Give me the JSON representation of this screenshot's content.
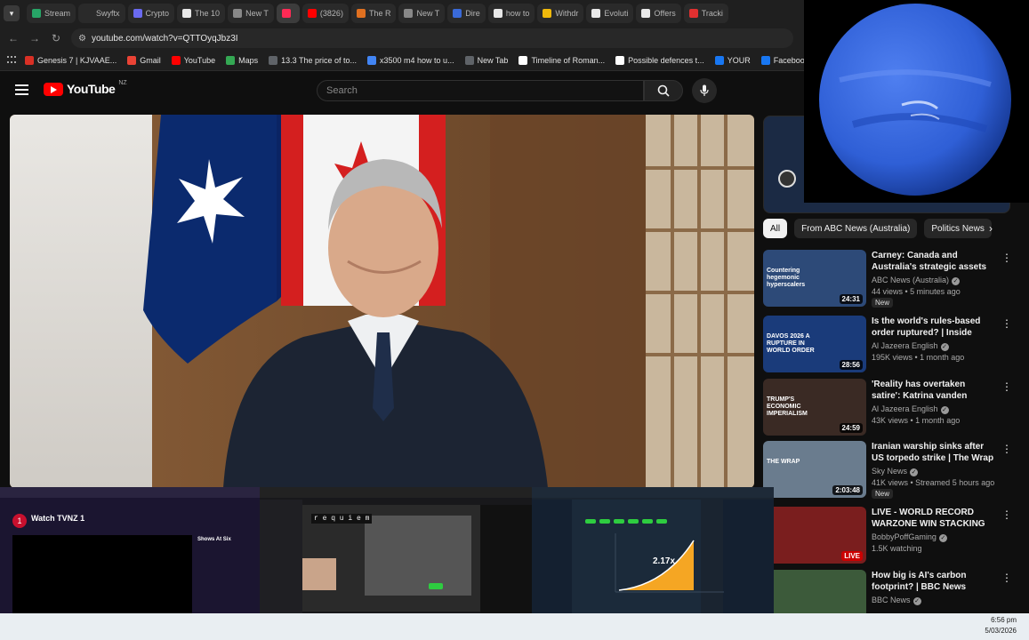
{
  "browser": {
    "tabs": [
      {
        "label": "Stream",
        "color": "#27a567"
      },
      {
        "label": "Swyftx",
        "color": "#2a2a2a"
      },
      {
        "label": "Crypto",
        "color": "#6a6af0"
      },
      {
        "label": "The 10",
        "color": "#e8e8e8"
      },
      {
        "label": "New T",
        "color": "#888888"
      },
      {
        "label": "",
        "color": "#ff2a55",
        "active": true
      },
      {
        "label": "(3826)",
        "color": "#ff0000"
      },
      {
        "label": "The R",
        "color": "#e07020"
      },
      {
        "label": "New T",
        "color": "#888888"
      },
      {
        "label": "Dire",
        "color": "#3a6ad8"
      },
      {
        "label": "how to",
        "color": "#e8e8e8"
      },
      {
        "label": "Withdr",
        "color": "#f0b90b"
      },
      {
        "label": "Evoluti",
        "color": "#e8e8e8"
      },
      {
        "label": "Offers",
        "color": "#e8e8e8"
      },
      {
        "label": "Tracki",
        "color": "#e03030"
      }
    ],
    "url": "youtube.com/watch?v=QTTOyqJbz3I",
    "bookmarks": [
      {
        "label": "Genesis 7 | KJVAAE...",
        "color": "#d93025"
      },
      {
        "label": "Gmail",
        "color": "#ea4335"
      },
      {
        "label": "YouTube",
        "color": "#ff0000"
      },
      {
        "label": "Maps",
        "color": "#34a853"
      },
      {
        "label": "13.3 The price of to...",
        "color": "#5f6368"
      },
      {
        "label": "x3500 m4 how to u...",
        "color": "#4285f4"
      },
      {
        "label": "New Tab",
        "color": "#5f6368"
      },
      {
        "label": "Timeline of Roman...",
        "color": "#ffffff"
      },
      {
        "label": "Possible defences t...",
        "color": "#ffffff"
      },
      {
        "label": "YOUR",
        "color": "#1877f2"
      },
      {
        "label": "Facebook green",
        "color": "#1877f2"
      }
    ]
  },
  "youtube": {
    "logo_text": "YouTube",
    "country": "NZ",
    "search_placeholder": "Search",
    "chips": [
      "All",
      "From ABC News (Australia)",
      "Politics News"
    ],
    "recommendations": [
      {
        "title": "Carney: Canada and Australia's strategic assets to counter ...",
        "channel": "ABC News (Australia)",
        "meta": "44 views • 5 minutes ago",
        "badge": "New",
        "duration": "24:31",
        "thumb_text": "Countering hegemonic hyperscalers",
        "thumb_color": "#2d4a78"
      },
      {
        "title": "Is the world's rules-based order ruptured? | Inside Story",
        "channel": "Al Jazeera English",
        "meta": "195K views • 1 month ago",
        "badge": "",
        "duration": "28:56",
        "thumb_text": "DAVOS 2026 A RUPTURE IN WORLD ORDER",
        "thumb_color": "#1a3b7a"
      },
      {
        "title": "'Reality has overtaken satire': Katrina vanden Heuvel on ...",
        "channel": "Al Jazeera English",
        "meta": "43K views • 1 month ago",
        "badge": "",
        "duration": "24:59",
        "thumb_text": "TRUMP'S ECONOMIC IMPERIALISM",
        "thumb_color": "#3a2a24"
      },
      {
        "title": "Iranian warship sinks after US torpedo strike | The Wrap with ...",
        "channel": "Sky News",
        "meta": "41K views • Streamed 5 hours ago",
        "badge": "New",
        "duration": "2:03:48",
        "thumb_text": "THE WRAP",
        "thumb_color": "#6a7c8e"
      },
      {
        "title": "LIVE - WORLD RECORD WARZONE WIN STACKING",
        "channel": "BobbyPoffGaming",
        "meta": "1.5K watching",
        "badge": "",
        "duration": "LIVE",
        "thumb_text": "",
        "thumb_color": "#7a1e1e"
      },
      {
        "title": "How big is AI's carbon footprint? | BBC News",
        "channel": "BBC News",
        "meta": "",
        "badge": "",
        "duration": "",
        "thumb_text": "",
        "thumb_color": "#3c5a3a"
      }
    ]
  },
  "overlays": {
    "win1_title": "Watch TVNZ 1",
    "win1_side_heading": "Shows At Six",
    "win2_overlay_text": "r e q u i e m",
    "win3_multiplier": "2.17x"
  },
  "taskbar": {
    "time": "6:56 pm",
    "date": "5/03/2026"
  },
  "colors": {
    "youtube_red": "#ff0000",
    "neptune_blue": "#2f5fd6",
    "chart_orange": "#f5a623"
  }
}
